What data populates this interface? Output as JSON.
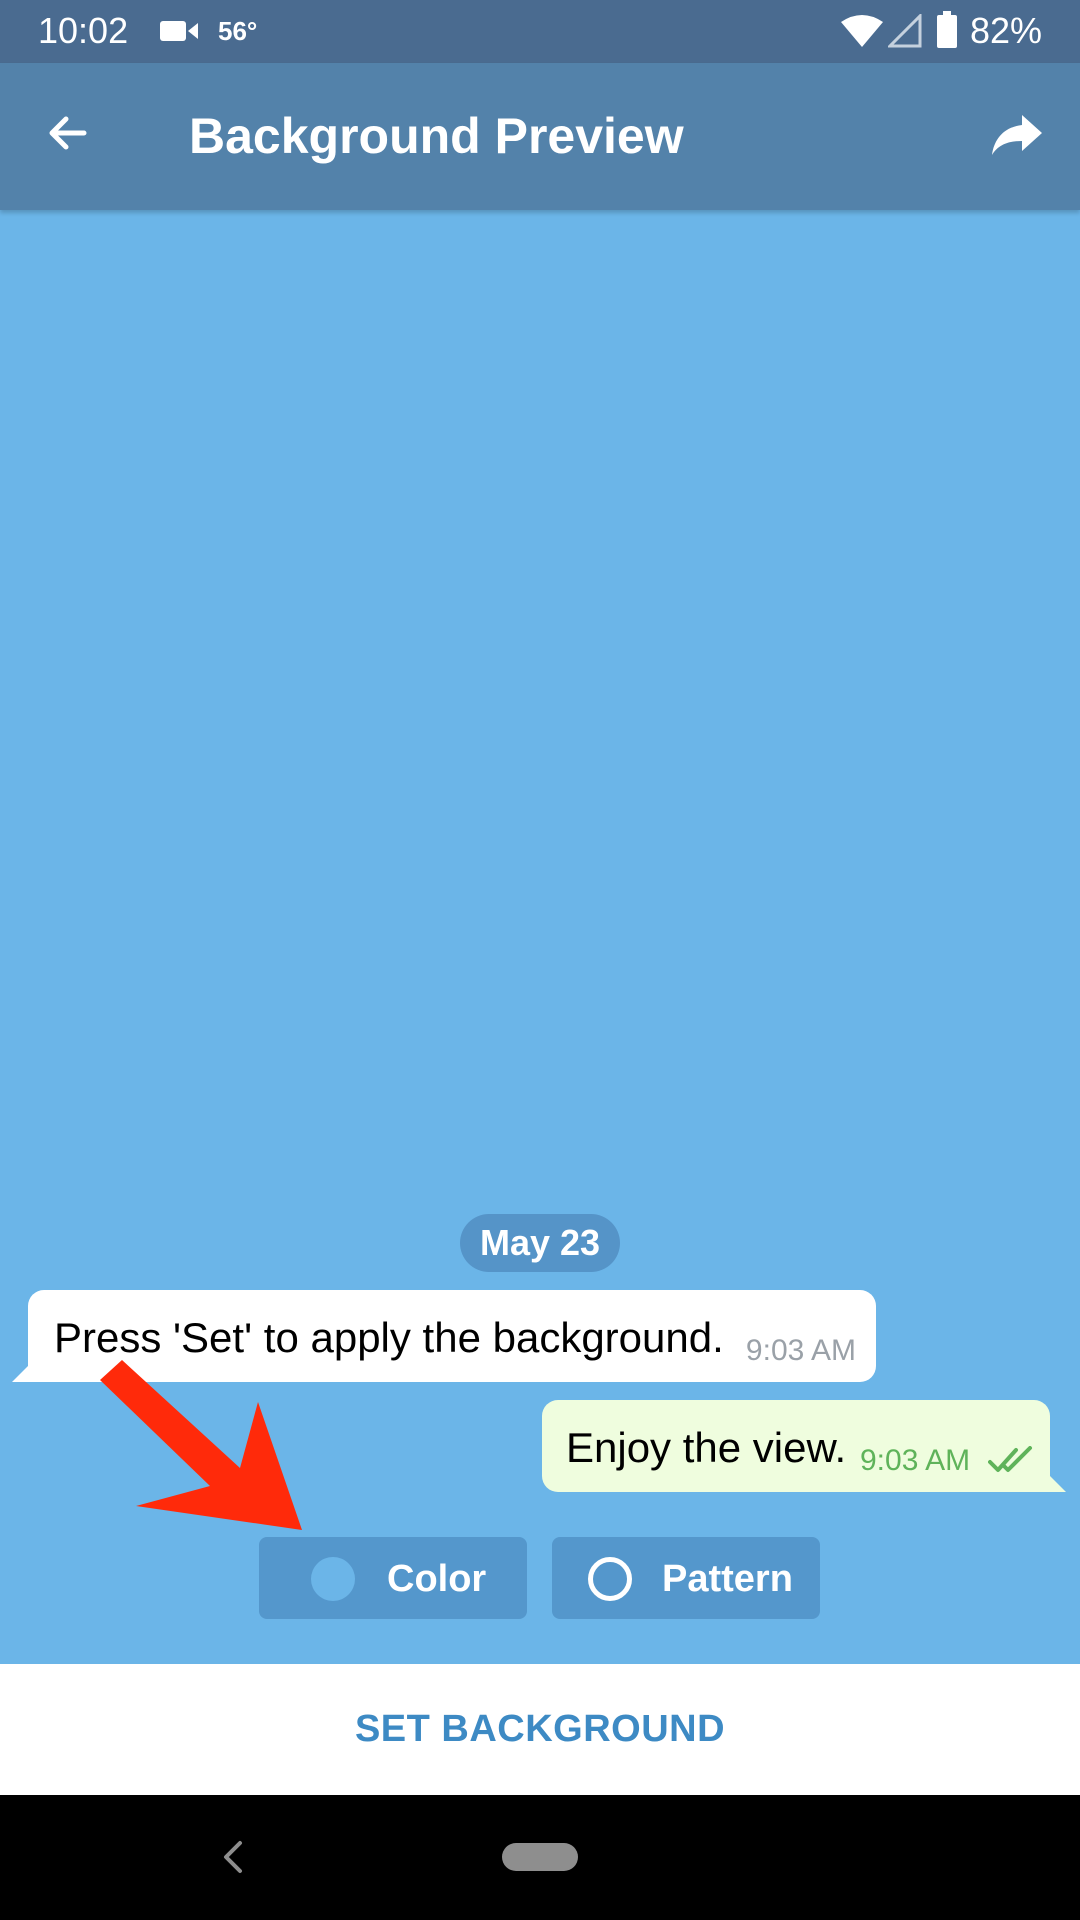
{
  "status_bar": {
    "time": "10:02",
    "temperature": "56°",
    "battery_percent": "82%",
    "icons": [
      "video-camera-icon",
      "wifi-icon",
      "signal-icon",
      "battery-icon"
    ]
  },
  "app_bar": {
    "title": "Background Preview",
    "back_icon": "back-arrow-icon",
    "share_icon": "share-icon"
  },
  "chat": {
    "date_label": "May 23",
    "messages": [
      {
        "direction": "incoming",
        "text": "Press 'Set' to apply the background.",
        "time": "9:03 AM"
      },
      {
        "direction": "outgoing",
        "text": "Enjoy the view.",
        "time": "9:03 AM",
        "status_icon": "double-check-icon"
      }
    ]
  },
  "options": {
    "color_label": "Color",
    "pattern_label": "Pattern"
  },
  "bottom": {
    "set_background_label": "SET BACKGROUND"
  },
  "colors": {
    "background": "#6bb5e8",
    "app_bar": "#5382aa",
    "status_bar": "#4a6b90",
    "accent_text": "#3d8ac4",
    "annotation_arrow": "#ff2a0a"
  }
}
